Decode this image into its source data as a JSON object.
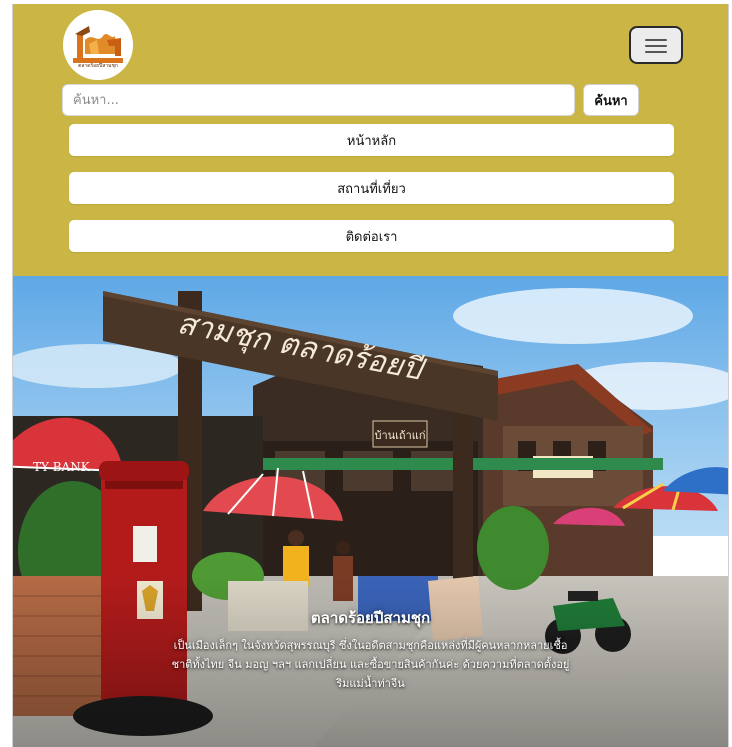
{
  "brand": {
    "logo_text": "ตลาดร้อยปีสามชุก",
    "logo_caption": "ตลาดร้อยปีสามชุก"
  },
  "header": {
    "background_color": "#cbb545",
    "menu_icon": "hamburger-icon"
  },
  "search": {
    "placeholder": "ค้นหา...",
    "value": "",
    "button_label": "ค้นหา"
  },
  "nav": {
    "items": [
      {
        "label": "หน้าหลัก"
      },
      {
        "label": "สถานที่เที่ยว"
      },
      {
        "label": "ติดต่อเรา"
      }
    ]
  },
  "hero": {
    "sign_text": "สามชุก ตลาดร้อยปี",
    "sub_sign_text": "บ้านเถ้าแก่",
    "bank_text": "TY BANK",
    "caption_title": "ตลาดร้อยปีสามชุก",
    "caption_lines": [
      "เป็นเมืองเล็กๆ ในจังหวัดสุพรรณบุรี ซึ่งในอดีตสามชุกคือแหล่งที่มีผู้คนหลากหลายเชื้อ",
      "ชาติทั้งไทย จีน มอญ ฯลฯ แลกเปลี่ยน และซื้อขายสินค้ากันค่ะ ด้วยความที่ตลาดตั้งอยู่",
      "ริมแม่น้ำท่าจีน"
    ]
  }
}
